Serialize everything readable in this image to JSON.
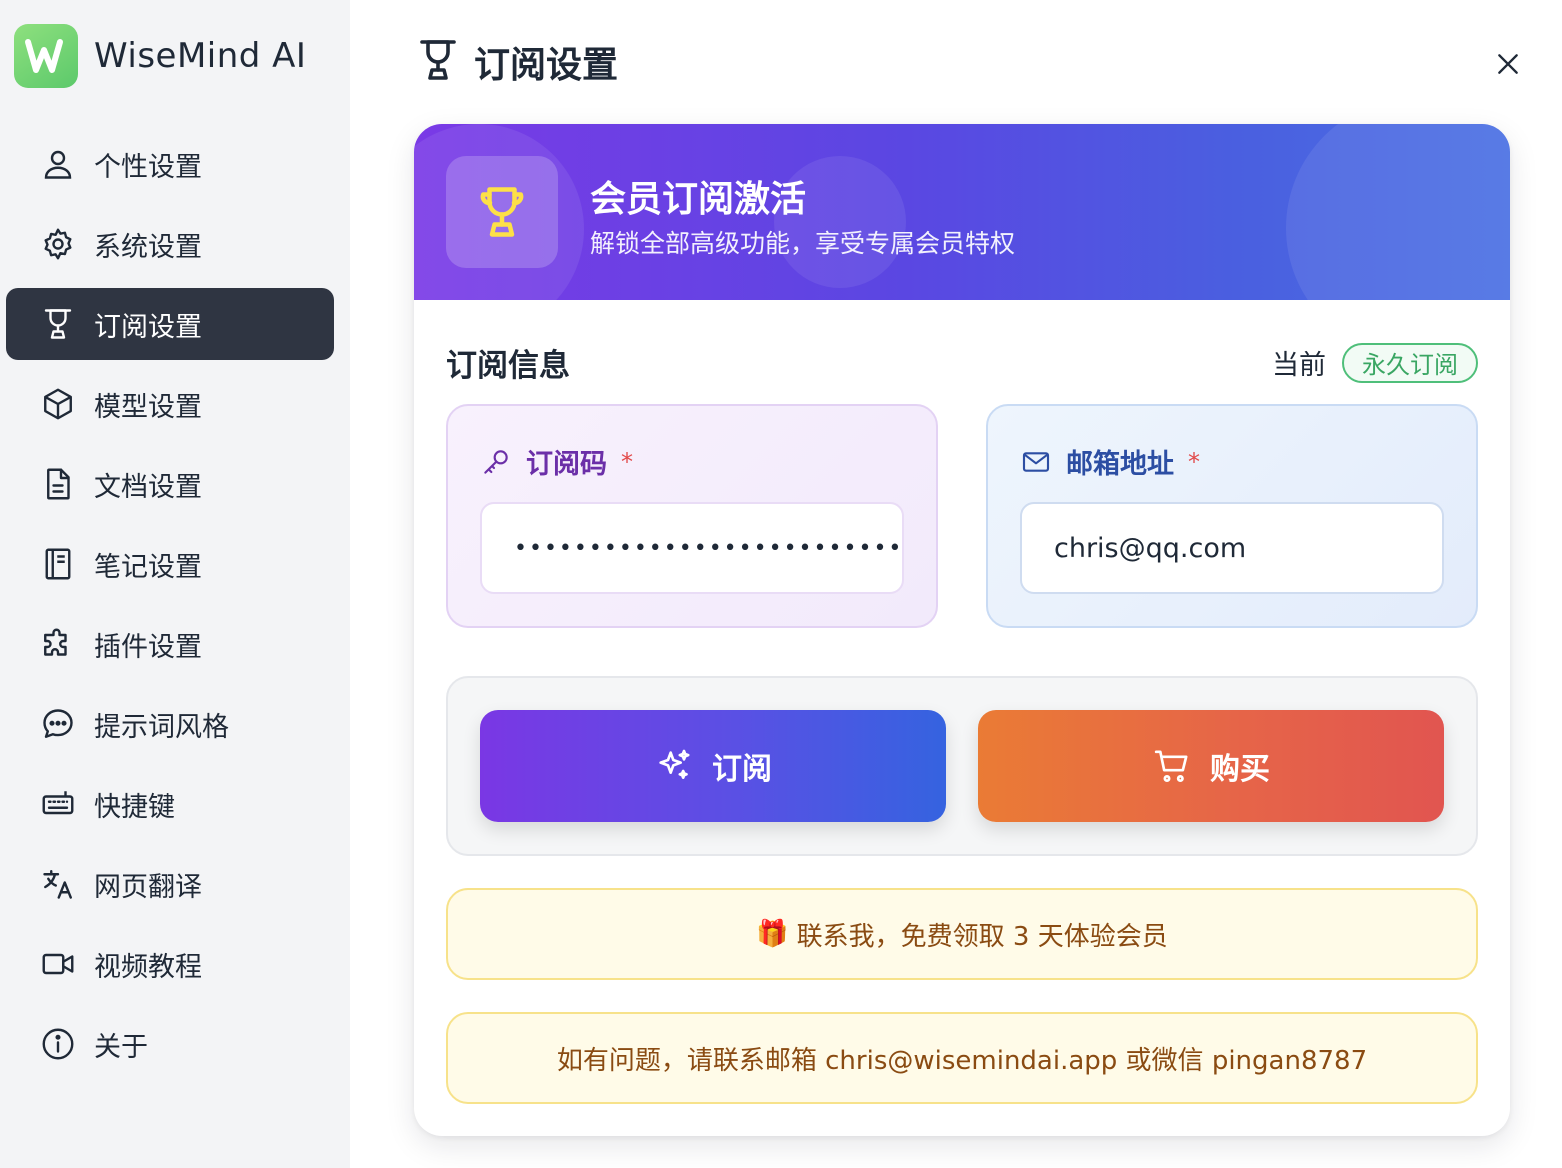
{
  "app": {
    "name": "WiseMind AI",
    "logo_letter": "W",
    "brand_color": "#6fd47a"
  },
  "sidebar": {
    "items": [
      {
        "label": "个性设置",
        "icon": "user-icon",
        "active": false
      },
      {
        "label": "系统设置",
        "icon": "gear-icon",
        "active": false
      },
      {
        "label": "订阅设置",
        "icon": "trophy-icon",
        "active": true
      },
      {
        "label": "模型设置",
        "icon": "cube-icon",
        "active": false
      },
      {
        "label": "文档设置",
        "icon": "document-icon",
        "active": false
      },
      {
        "label": "笔记设置",
        "icon": "notebook-icon",
        "active": false
      },
      {
        "label": "插件设置",
        "icon": "puzzle-icon",
        "active": false
      },
      {
        "label": "提示词风格",
        "icon": "chat-bubble-icon",
        "active": false
      },
      {
        "label": "快捷键",
        "icon": "keyboard-icon",
        "active": false
      },
      {
        "label": "网页翻译",
        "icon": "translate-icon",
        "active": false
      },
      {
        "label": "视频教程",
        "icon": "video-icon",
        "active": false
      },
      {
        "label": "关于",
        "icon": "info-icon",
        "active": false
      }
    ]
  },
  "header": {
    "title": "订阅设置",
    "icon": "trophy-icon"
  },
  "banner": {
    "title": "会员订阅激活",
    "subtitle": "解锁全部高级功能，享受专属会员特权",
    "icon": "trophy-icon"
  },
  "subscription": {
    "section_title": "订阅信息",
    "current_label": "当前",
    "plan": "永久订阅",
    "plan_color": "#3aa663"
  },
  "fields": {
    "code": {
      "label": "订阅码",
      "required_mark": "*",
      "masked_value": "••••••••••••••••••••••••••••••",
      "icon": "key-icon"
    },
    "email": {
      "label": "邮箱地址",
      "required_mark": "*",
      "value": "chris@qq.com",
      "icon": "mail-icon"
    }
  },
  "actions": {
    "subscribe_label": "订阅",
    "subscribe_icon": "sparkles-icon",
    "buy_label": "购买",
    "buy_icon": "cart-icon"
  },
  "notices": {
    "trial_emoji": "🎁",
    "trial_text": "联系我，免费领取 3 天体验会员",
    "contact_text": "如有问题，请联系邮箱 chris@wisemindai.app 或微信 pingan8787"
  }
}
